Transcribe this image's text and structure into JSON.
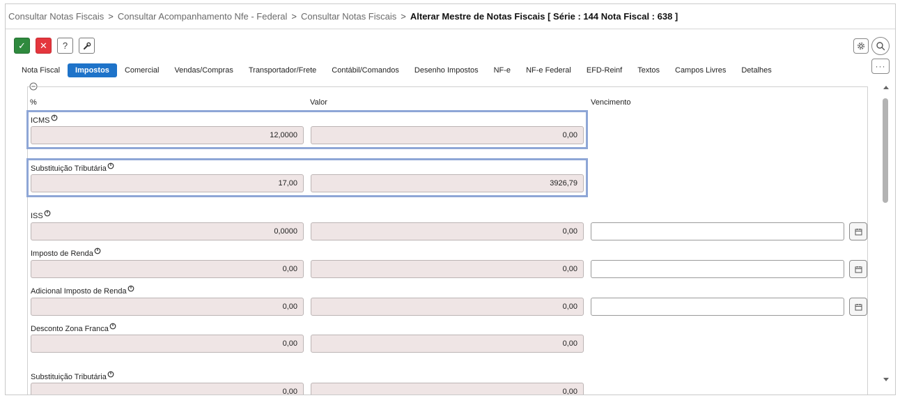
{
  "breadcrumb": {
    "items": [
      "Consultar Notas Fiscais",
      "Consultar Acompanhamento Nfe - Federal",
      "Consultar Notas Fiscais"
    ],
    "separator": ">",
    "current": "Alterar Mestre de Notas Fiscais [ Série : 144 Nota Fiscal : 638 ]"
  },
  "toolbar": {
    "ok_glyph": "✓",
    "cancel_glyph": "✕",
    "help_glyph": "?",
    "more_glyph": "···"
  },
  "tabs": [
    "Nota Fiscal",
    "Impostos",
    "Comercial",
    "Vendas/Compras",
    "Transportador/Frete",
    "Contábil/Comandos",
    "Desenho Impostos",
    "NF-e",
    "NF-e Federal",
    "EFD-Reinf",
    "Textos",
    "Campos Livres",
    "Detalhes"
  ],
  "active_tab": "Impostos",
  "columns": {
    "percent": "%",
    "value": "Valor",
    "due": "Vencimento"
  },
  "fields": [
    {
      "label": "ICMS",
      "percent": "12,0000",
      "value": "0,00",
      "has_due": false
    },
    {
      "label": "Substituição Tributária",
      "percent": "17,00",
      "value": "3926,79",
      "has_due": false
    },
    {
      "label": "ISS",
      "percent": "0,0000",
      "value": "0,00",
      "has_due": true,
      "due": ""
    },
    {
      "label": "Imposto de Renda",
      "percent": "0,00",
      "value": "0,00",
      "has_due": true,
      "due": ""
    },
    {
      "label": "Adicional Imposto de Renda",
      "percent": "0,00",
      "value": "0,00",
      "has_due": true,
      "due": ""
    },
    {
      "label": "Desconto Zona Franca",
      "percent": "0,00",
      "value": "0,00",
      "has_due": false
    },
    {
      "label": "Substituição Tributária",
      "percent": "0,00",
      "value": "0,00",
      "has_due": false
    }
  ],
  "colors": {
    "accent": "#1e73c9",
    "ok": "#2f8a3e",
    "cancel": "#e4363d",
    "readonly_bg": "#efe5e5",
    "highlight": "#8ea6d6"
  }
}
